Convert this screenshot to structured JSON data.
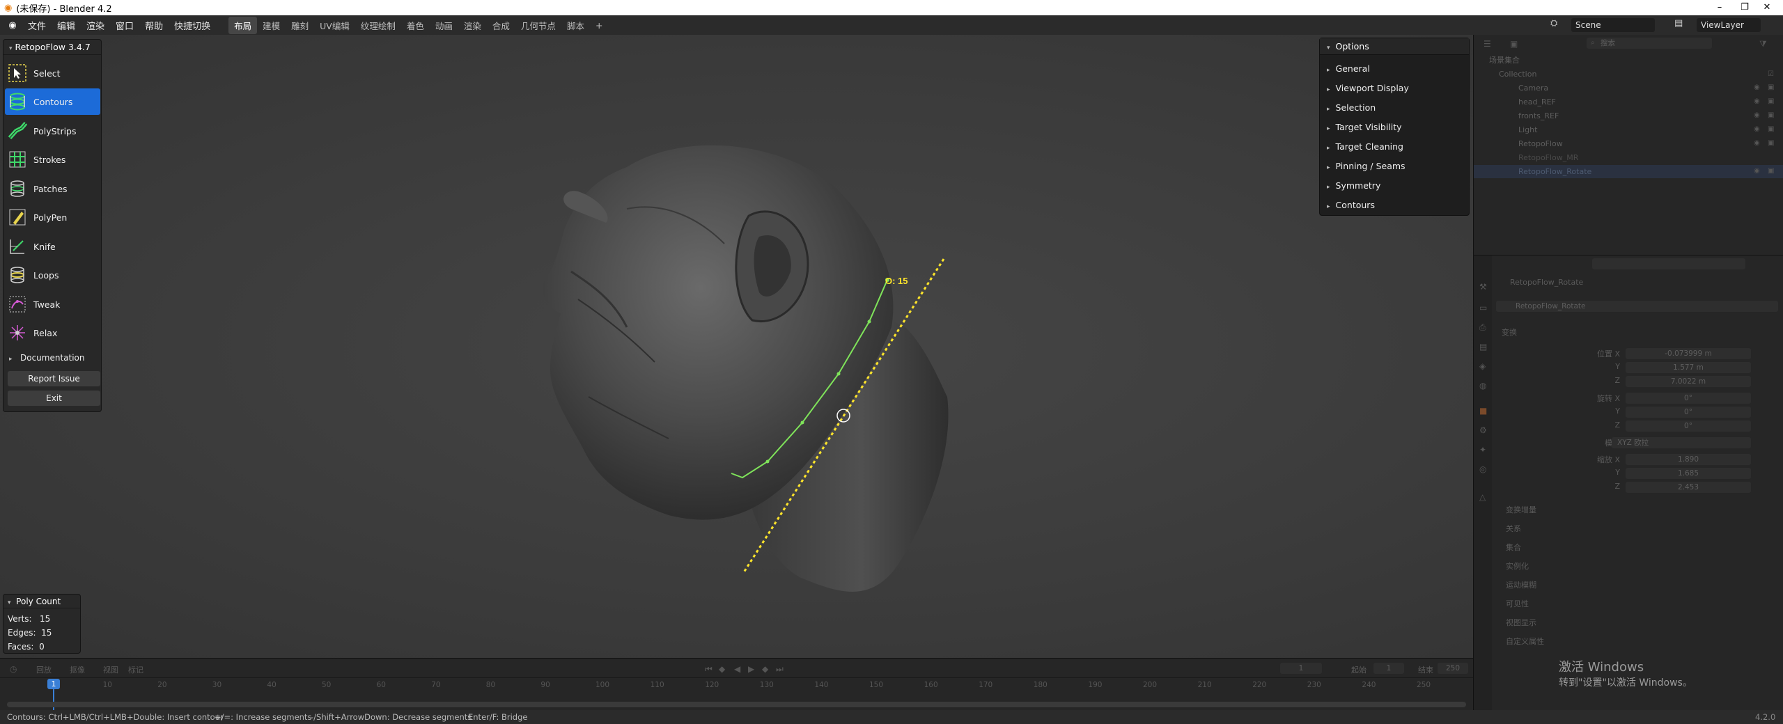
{
  "window": {
    "title": "(未保存) - Blender 4.2",
    "minimize": "–",
    "maximize": "❐",
    "close": "✕"
  },
  "menu": {
    "items": [
      "文件",
      "编辑",
      "渲染",
      "窗口",
      "帮助",
      "快捷切换"
    ]
  },
  "workspaces": {
    "items": [
      "布局",
      "建模",
      "雕刻",
      "UV编辑",
      "纹理绘制",
      "着色",
      "动画",
      "渲染",
      "合成",
      "几何节点",
      "脚本",
      "+"
    ],
    "active": "布局"
  },
  "header_right": {
    "scene": "Scene",
    "view_layer": "ViewLayer"
  },
  "retopoflow": {
    "title": "RetopoFlow 3.4.7",
    "tools": [
      {
        "label": "Select",
        "icon": "select-icon"
      },
      {
        "label": "Contours",
        "icon": "contours-icon"
      },
      {
        "label": "PolyStrips",
        "icon": "polystrips-icon"
      },
      {
        "label": "Strokes",
        "icon": "strokes-icon"
      },
      {
        "label": "Patches",
        "icon": "patches-icon"
      },
      {
        "label": "PolyPen",
        "icon": "polypen-icon"
      },
      {
        "label": "Knife",
        "icon": "knife-icon"
      },
      {
        "label": "Loops",
        "icon": "loops-icon"
      },
      {
        "label": "Tweak",
        "icon": "tweak-icon"
      },
      {
        "label": "Relax",
        "icon": "relax-icon"
      }
    ],
    "active_tool": "Contours",
    "documentation": "Documentation",
    "report_issue": "Report Issue",
    "exit": "Exit"
  },
  "options": {
    "title": "Options",
    "items": [
      "General",
      "Viewport Display",
      "Selection",
      "Target Visibility",
      "Target Cleaning",
      "Pinning / Seams",
      "Symmetry",
      "Contours"
    ]
  },
  "poly_count": {
    "title": "Poly Count",
    "verts_label": "Verts:",
    "verts": "15",
    "edges_label": "Edges:",
    "edges": "15",
    "faces_label": "Faces:",
    "faces": "0"
  },
  "viewport": {
    "contour_label": "O: 15"
  },
  "outliner": {
    "search_placeholder": "搜索",
    "rows": [
      "场景集合",
      "Collection",
      "Camera",
      "head_REF",
      "fronts_REF",
      "Light",
      "RetopoFlow",
      "RetopoFlow_MR",
      "RetopoFlow_Rotate"
    ],
    "selected": "RetopoFlow_Rotate"
  },
  "properties": {
    "object_name": "RetopoFlow_Rotate",
    "mesh_name": "RetopoFlow_Rotate",
    "section_transform": "变换",
    "location_label": "位置 X",
    "loc_x": "-0.073999 m",
    "loc_y": "1.577 m",
    "loc_z": "7.0022 m",
    "rotation_label": "旋转 X",
    "rot_x": "0°",
    "rot_y": "0°",
    "rot_z": "0°",
    "mode_label": "模式",
    "mode_value": "XYZ 欧拉",
    "scale_label": "缩放 X",
    "scale_x": "1.890",
    "scale_y": "1.685",
    "scale_z": "2.453",
    "axis_y": "Y",
    "axis_z": "Z",
    "subsections": [
      "变换增量",
      "关系",
      "集合",
      "实例化",
      "运动模糊",
      "可见性",
      "视图显示",
      "自定义属性"
    ]
  },
  "timeline": {
    "menu": [
      "回放",
      "抠像",
      "视图",
      "标记"
    ],
    "current_frame": "1",
    "ticks": [
      "10",
      "20",
      "30",
      "40",
      "50",
      "60",
      "70",
      "80",
      "90",
      "100",
      "110",
      "120",
      "130",
      "140",
      "150",
      "160",
      "170",
      "180",
      "190",
      "200",
      "210",
      "220",
      "230",
      "240",
      "250"
    ],
    "start_label": "起始",
    "start": "1",
    "end_label": "结束",
    "end": "250",
    "frame_field": "1"
  },
  "watermark": {
    "line1": "激活 Windows",
    "line2": "转到\"设置\"以激活 Windows。"
  },
  "status": {
    "hints": [
      "Contours: Ctrl+LMB/Ctrl+LMB+Double: Insert contour",
      "+/=: Increase segments",
      "-/Shift+ArrowDown: Decrease segments",
      "Enter/F: Bridge"
    ],
    "version": "4.2.0"
  },
  "colors": {
    "accent": "#1c6bd8",
    "tool_green": "#3fd86a",
    "contour_yellow": "#ffe52b",
    "contour_green": "#7fe35a"
  }
}
